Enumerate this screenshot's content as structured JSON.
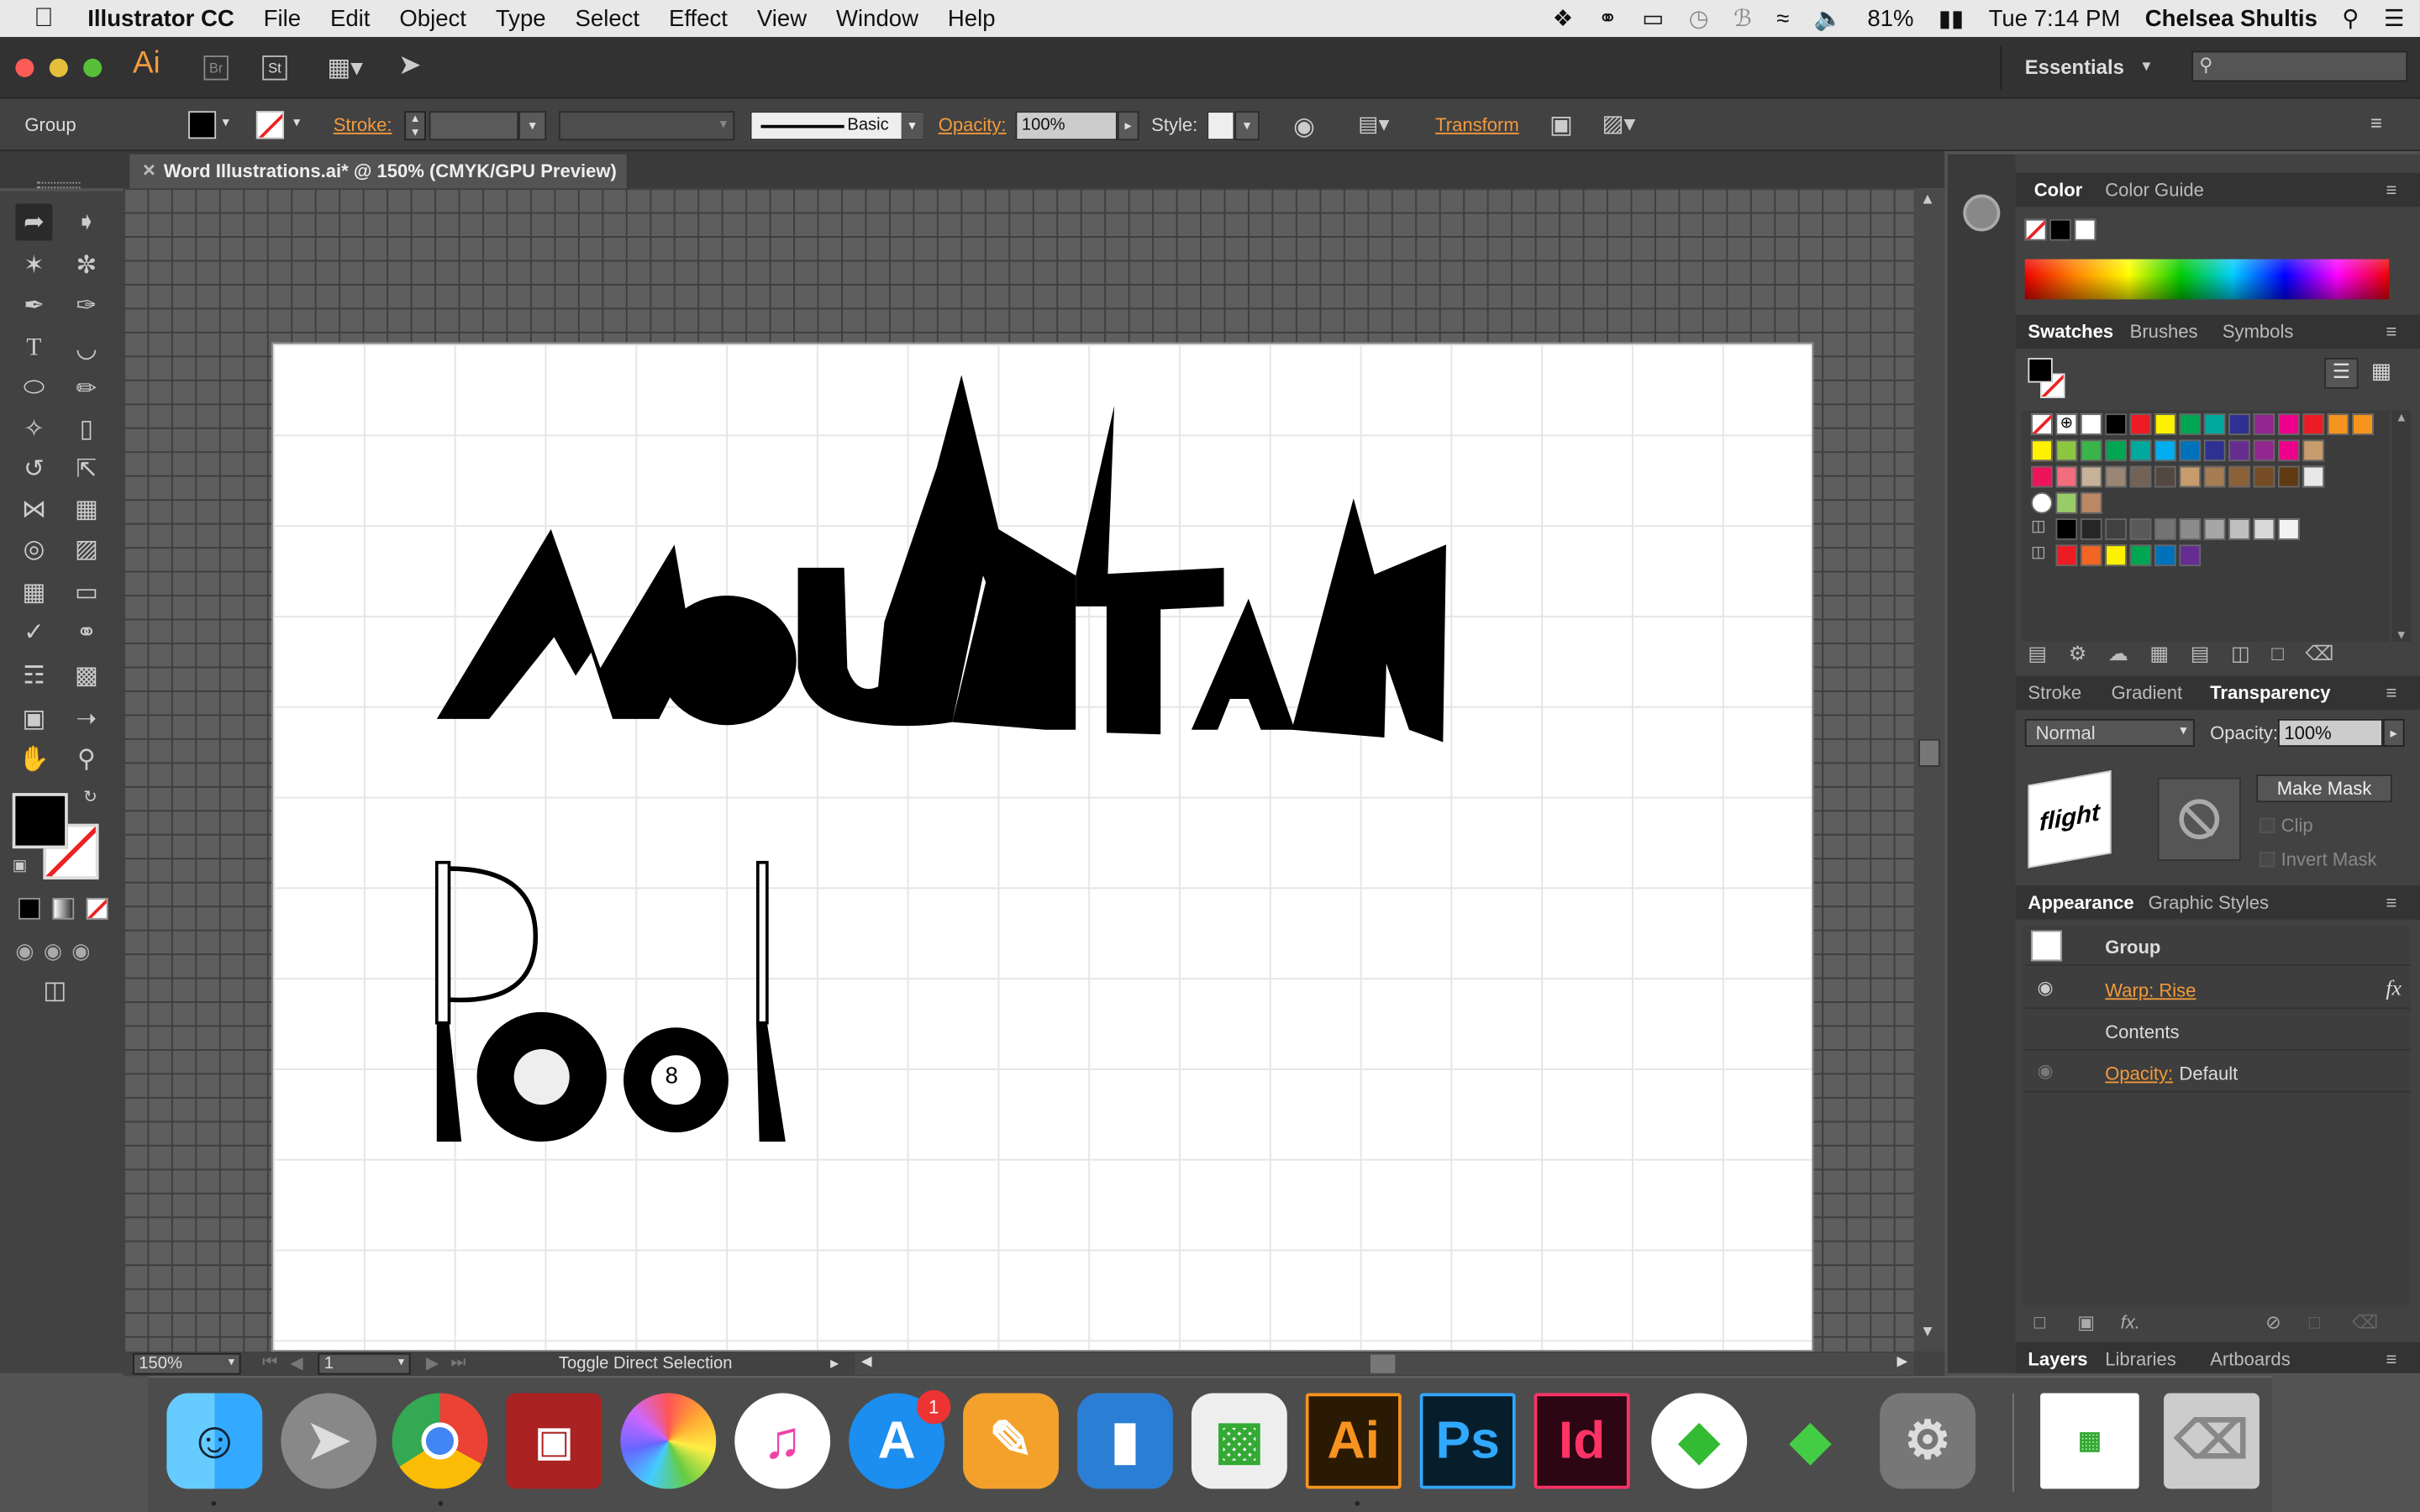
{
  "menubar": {
    "app": "Illustrator CC",
    "items": [
      "File",
      "Edit",
      "Object",
      "Type",
      "Select",
      "Effect",
      "View",
      "Window",
      "Help"
    ],
    "battery": "81%",
    "clock": "Tue 7:14 PM",
    "user": "Chelsea Shultis"
  },
  "appbar": {
    "logo": "Ai",
    "bridge": "Br",
    "stock": "St",
    "workspace": "Essentials"
  },
  "control": {
    "selection": "Group",
    "stroke_label": "Stroke:",
    "brush": "Basic",
    "opacity_label": "Opacity:",
    "opacity_value": "100%",
    "style_label": "Style:",
    "transform_label": "Transform"
  },
  "document": {
    "tab": "Word Illustrations.ai* @ 150% (CMYK/GPU Preview)"
  },
  "artwork": {
    "word1": "MOUNTAIN",
    "word2": "Pool",
    "ball_number": "8"
  },
  "status": {
    "zoom": "150%",
    "artboard": "1",
    "hint": "Toggle Direct Selection"
  },
  "color_panel": {
    "tabs": [
      "Color",
      "Color Guide"
    ]
  },
  "swatches_panel": {
    "tabs": [
      "Swatches",
      "Brushes",
      "Symbols"
    ],
    "row1": [
      "#ffffff",
      "#000000",
      "#ed1c24",
      "#fff200",
      "#00a651",
      "#00a99d",
      "#2e3192",
      "#92278f",
      "#ec008c",
      "#ed1c24",
      "#f7941d",
      "#f7941d"
    ],
    "row2": [
      "#fff200",
      "#8dc63f",
      "#39b54a",
      "#00a651",
      "#00a99d",
      "#00aeef",
      "#0072bc",
      "#2e3192",
      "#662d91",
      "#92278f",
      "#ec008c",
      "#c69c6d"
    ],
    "row3": [
      "#ed145b",
      "#f26d7d",
      "#c7b299",
      "#998675",
      "#736357",
      "#534741",
      "#c69c6d",
      "#a67c52",
      "#8c6239",
      "#754c24",
      "#603913",
      "#e8e8e8"
    ],
    "row5": [
      "#000000",
      "#262626",
      "#404040",
      "#595959",
      "#737373",
      "#8c8c8c",
      "#a6a6a6",
      "#bfbfbf",
      "#d9d9d9",
      "#f2f2f2"
    ],
    "row6": [
      "#ed1c24",
      "#f26522",
      "#fff200",
      "#00a651",
      "#0072bc",
      "#662d91"
    ]
  },
  "transparency_panel": {
    "tabs": [
      "Stroke",
      "Gradient",
      "Transparency"
    ],
    "mode": "Normal",
    "opacity_label": "Opacity:",
    "opacity_value": "100%",
    "make_mask": "Make Mask",
    "clip": "Clip",
    "invert": "Invert Mask",
    "thumb_text": "flight"
  },
  "appearance_panel": {
    "tabs": [
      "Appearance",
      "Graphic Styles"
    ],
    "rows": [
      "Group",
      "Warp: Rise",
      "Contents",
      "Opacity:",
      "Default"
    ],
    "fx": "fx"
  },
  "layers_panel": {
    "tabs": [
      "Layers",
      "Libraries",
      "Artboards"
    ]
  },
  "dock": {
    "badge": "1",
    "ai": "Ai",
    "ps": "Ps",
    "id": "Id"
  }
}
